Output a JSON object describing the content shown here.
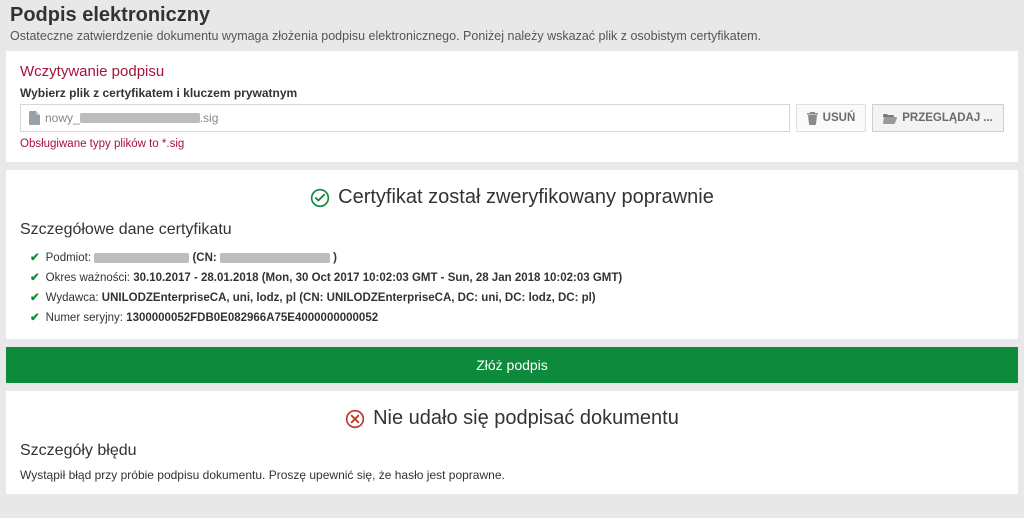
{
  "header": {
    "title": "Podpis elektroniczny",
    "subtitle": "Ostateczne zatwierdzenie dokumentu wymaga złożenia podpisu elektronicznego. Poniżej należy wskazać plik z osobistym certyfikatem."
  },
  "upload": {
    "section_title": "Wczytywanie podpisu",
    "field_label": "Wybierz plik z certyfikatem i kluczem prywatnym",
    "file_prefix": "nowy_",
    "file_suffix": ".sig",
    "delete_label": "USUŃ",
    "browse_label": "PRZEGLĄDAJ ...",
    "help_text": "Obsługiwane typy plików to *.sig"
  },
  "cert": {
    "banner": "Certyfikat został zweryfikowany poprawnie",
    "details_title": "Szczegółowe dane certyfikatu",
    "rows": {
      "subject_label": "Podmiot:",
      "subject_cn_prefix": "(CN:",
      "subject_cn_suffix": ")",
      "validity_label": "Okres ważności:",
      "validity_value": "30.10.2017 - 28.01.2018 (Mon, 30 Oct 2017 10:02:03 GMT - Sun, 28 Jan 2018 10:02:03 GMT)",
      "issuer_label": "Wydawca:",
      "issuer_value": "UNILODZEnterpriseCA, uni, lodz, pl (CN: UNILODZEnterpriseCA, DC: uni, DC: lodz, DC: pl)",
      "serial_label": "Numer seryjny:",
      "serial_value": "1300000052FDB0E082966A75E4000000000052"
    }
  },
  "submit": {
    "label": "Złóż podpis"
  },
  "error": {
    "banner": "Nie udało się podpisać dokumentu",
    "details_title": "Szczegóły błędu",
    "message": "Wystąpił błąd przy próbie podpisu dokumentu. Proszę upewnić się, że hasło jest poprawne."
  },
  "colors": {
    "accent_red": "#a6133b",
    "accent_green": "#0e8a3d"
  }
}
